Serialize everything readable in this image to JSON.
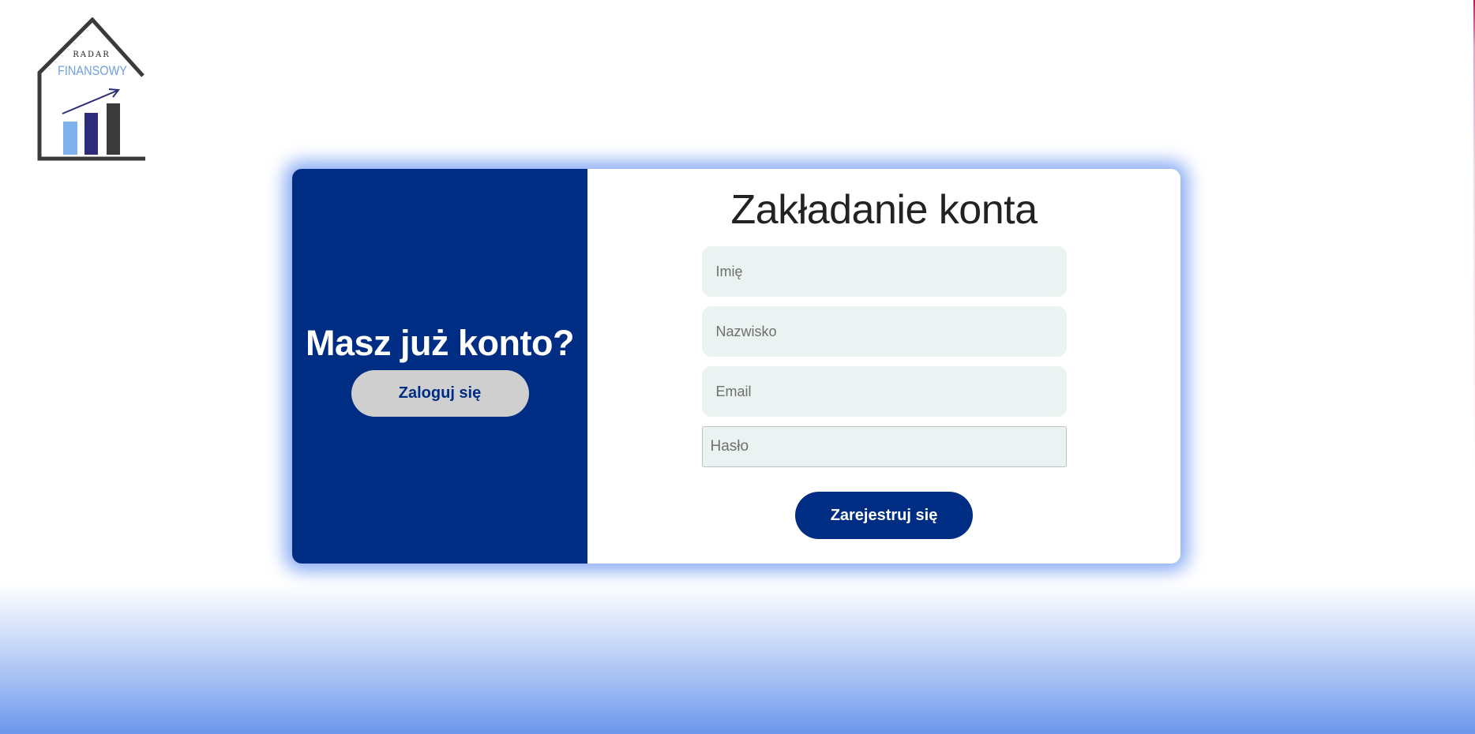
{
  "logo": {
    "top_text": "RADAR",
    "main_text": "FINANSOWY",
    "icon": "house-chart-logo",
    "colors": {
      "outline": "#3a3a3a",
      "text_accent": "#6fa0e0",
      "bar_light": "#7fb2ec",
      "bar_dark": "#2d2c7a",
      "bar_gray": "#3a3a3a"
    }
  },
  "left_panel": {
    "title": "Masz już konto?",
    "login_button": "Zaloguj się"
  },
  "form": {
    "title": "Zakładanie konta",
    "first_name_placeholder": "Imię",
    "last_name_placeholder": "Nazwisko",
    "email_placeholder": "Email",
    "password_placeholder": "Hasło",
    "submit_button": "Zarejestruj się"
  },
  "colors": {
    "primary": "#002d84",
    "login_button_bg": "#cfcfcf",
    "input_bg": "#eaf3f1",
    "glow": "#6491f0"
  }
}
